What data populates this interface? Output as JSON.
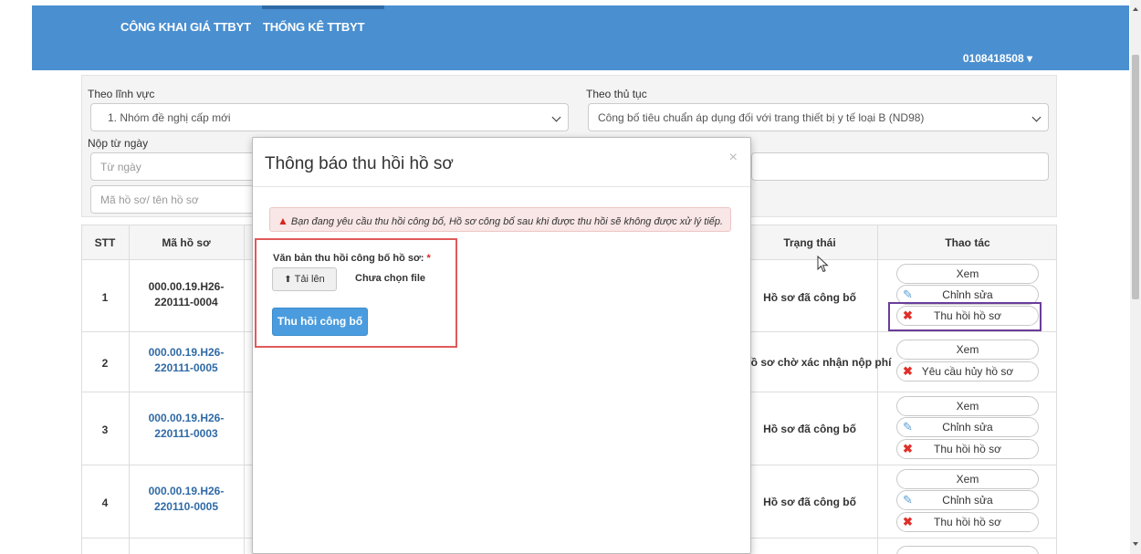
{
  "nav": {
    "links": [
      "CÔNG KHAI GIÁ TTBYT",
      "THỐNG KÊ TTBYT"
    ],
    "user": "0108418508 ▾"
  },
  "filters": {
    "field_label": "Theo lĩnh vực",
    "field_value": "1. Nhóm đề nghị cấp mới",
    "procedure_label": "Theo thủ tục",
    "procedure_value": "Công bố tiêu chuẩn áp dụng đối với trang thiết bị y tế loại B (ND98)",
    "from_date_label": "Nộp từ ngày",
    "from_date_placeholder": "Từ ngày",
    "search_placeholder": "Mã hồ sơ/ tên hồ sơ"
  },
  "table": {
    "headers": {
      "stt": "STT",
      "code": "Mã hồ sơ",
      "status": "Trạng thái",
      "actions": "Thao tác"
    },
    "rows": [
      {
        "stt": "1",
        "code": "000.00.19.H26-220111-0004",
        "status": "Hồ sơ đã công bố",
        "actions": [
          "Xem",
          "Chỉnh sửa",
          "Thu hồi hồ sơ"
        ]
      },
      {
        "stt": "2",
        "code": "000.00.19.H26-220111-0005",
        "status": "Hồ sơ chờ xác nhận nộp phí",
        "actions": [
          "Xem",
          "Yêu cầu hủy hồ sơ"
        ]
      },
      {
        "stt": "3",
        "code": "000.00.19.H26-220111-0003",
        "status": "Hồ sơ đã công bố",
        "actions": [
          "Xem",
          "Chỉnh sửa",
          "Thu hồi hồ sơ"
        ]
      },
      {
        "stt": "4",
        "code": "000.00.19.H26-220110-0005",
        "status": "Hồ sơ đã công bố",
        "actions": [
          "Xem",
          "Chỉnh sửa",
          "Thu hồi hồ sơ"
        ]
      }
    ]
  },
  "modal": {
    "title": "Thông báo thu hồi hồ sơ",
    "close": "×",
    "alert": "Bạn đang yêu cầu thu hồi công bố, Hồ sơ công bố sau khi được thu hồi sẽ không được xử lý tiếp.",
    "field_label": "Văn bản thu hồi công bố hồ sơ:",
    "required_mark": "*",
    "upload_label": "Tải lên",
    "file_status": "Chưa chọn file",
    "submit_label": "Thu hồi công bố"
  },
  "colors": {
    "header_blue": "#4a8fd0",
    "submit_blue": "#4a9cde",
    "annotation_red": "#e05a5a",
    "annotation_purple": "#6a3d9a"
  },
  "icons": [
    "upload-icon",
    "warning-icon",
    "wrench-icon",
    "delete-icon",
    "chevron-down-icon",
    "close-icon"
  ]
}
